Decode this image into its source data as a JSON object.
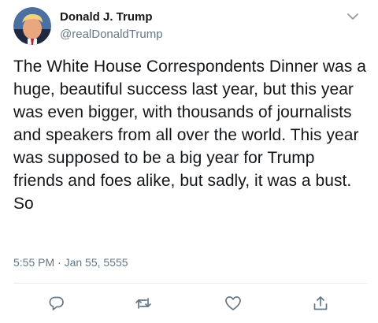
{
  "tweet": {
    "display_name": "Donald J. Trump",
    "handle": "@realDonaldTrump",
    "text": "The White House Correspondents Dinner was a huge, beautiful success last year, but this year was even bigger, with thousands of journalists and speakers from all over the world. This year was supposed to be a big year for Trump friends and foes alike, but sadly, it was a bust. So",
    "timestamp": "5:55 PM · Jan 55, 5555"
  },
  "icons": {
    "avatar": "profile-photo",
    "caret": "chevron-down-icon",
    "reply": "reply-icon",
    "retweet": "retweet-icon",
    "like": "heart-icon",
    "share": "share-icon"
  },
  "colors": {
    "text": "#14171a",
    "secondary": "#657786",
    "divider": "#e6ecf0"
  }
}
